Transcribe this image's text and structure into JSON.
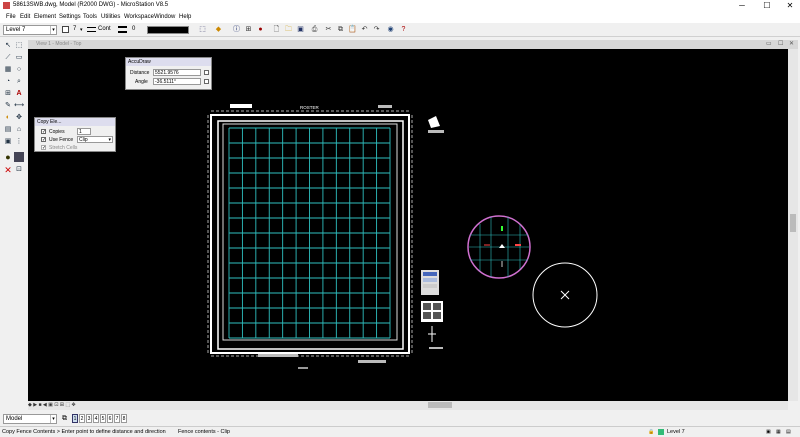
{
  "window": {
    "title": "58613SWB.dwg, Model (R2000 DWG) - MicroStation V8.5",
    "minimize": "─",
    "maximize": "☐",
    "close": "✕"
  },
  "menu": [
    "File",
    "Edit",
    "Element",
    "Settings",
    "Tools",
    "Utilities",
    "Workspace",
    "Window",
    "Help"
  ],
  "attributes": {
    "level": "Level 7",
    "color_index": "7",
    "line_style": "Cont",
    "weight": "0"
  },
  "view": {
    "title": "View 1 - Model - Top"
  },
  "accudraw": {
    "title": "AccuDraw",
    "distance_label": "Distance",
    "distance_value": "5521.9576",
    "angle_label": "Angle",
    "angle_value": "-36.5111°"
  },
  "copy_panel": {
    "title": "Copy Ele...",
    "copies_label": "Copies",
    "copies_value": "1",
    "use_fence_label": "Use Fence",
    "use_fence_value": "Clip",
    "stretch_cells_label": "Stretch Cells"
  },
  "drawing": {
    "header_text": "ROSTER"
  },
  "bottom": {
    "model": "Model",
    "views": [
      "1",
      "2",
      "3",
      "4",
      "5",
      "6",
      "7",
      "8"
    ]
  },
  "status": {
    "prompt": "Copy Fence Contents > Enter point to define distance and direction",
    "fence_info": "Fence contents - Clip",
    "level": "Level 7"
  },
  "colors": {
    "grid": "#2fbfbf",
    "frame": "#ffffff",
    "circle_pink": "#d070d0",
    "background": "#000000"
  }
}
